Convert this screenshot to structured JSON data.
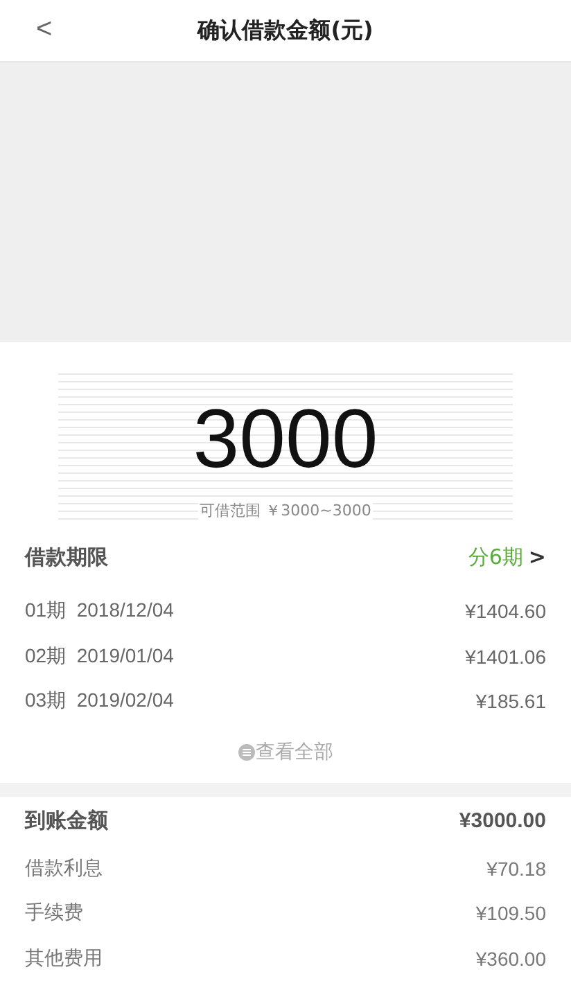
{
  "header": {
    "back": "<",
    "title": "确认借款金额(元)"
  },
  "amount": {
    "value": "3000",
    "range": "可借范围 ￥3000~3000"
  },
  "term": {
    "label": "借款期限",
    "value": "分6期",
    "arrow": ">"
  },
  "installments": [
    {
      "period": "01期",
      "date": "2018/12/04",
      "amount": "¥1404.60"
    },
    {
      "period": "02期",
      "date": "2019/01/04",
      "amount": "¥1401.06"
    },
    {
      "period": "03期",
      "date": "2019/02/04",
      "amount": "¥185.61"
    }
  ],
  "view_all": "查看全部",
  "summary": [
    {
      "label": "到账金额",
      "value": "¥3000.00",
      "kind": "total"
    },
    {
      "label": "借款利息",
      "value": "¥70.18",
      "kind": "item"
    },
    {
      "label": "手续费",
      "value": "¥109.50",
      "kind": "item"
    },
    {
      "label": "其他费用",
      "value": "¥360.00",
      "kind": "item"
    }
  ]
}
